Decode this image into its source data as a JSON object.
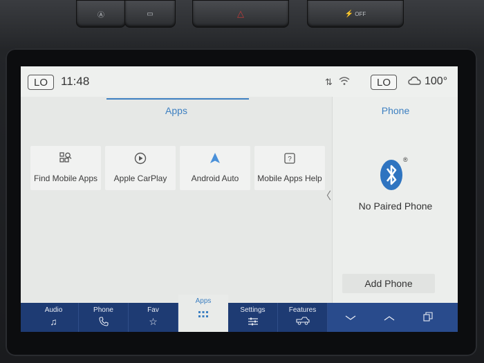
{
  "status": {
    "left_climate": "LO",
    "time": "11:48",
    "right_climate": "LO",
    "outside_temp": "100°"
  },
  "apps": {
    "title": "Apps",
    "tiles": [
      {
        "label": "Find Mobile Apps",
        "icon": "find-apps-icon"
      },
      {
        "label": "Apple CarPlay",
        "icon": "carplay-icon"
      },
      {
        "label": "Android Auto",
        "icon": "android-auto-icon"
      },
      {
        "label": "Mobile Apps Help",
        "icon": "help-icon"
      }
    ]
  },
  "phone": {
    "title": "Phone",
    "status": "No Paired Phone",
    "add_button": "Add Phone"
  },
  "nav": {
    "items": [
      {
        "label": "Audio",
        "icon": "music-note-icon"
      },
      {
        "label": "Phone",
        "icon": "phone-icon"
      },
      {
        "label": "Fav",
        "icon": "star-icon"
      },
      {
        "label": "Apps",
        "icon": "apps-grid-icon"
      },
      {
        "label": "Settings",
        "icon": "settings-sliders-icon"
      },
      {
        "label": "Features",
        "icon": "truck-icon"
      }
    ],
    "active": "Apps"
  },
  "dash_buttons": {
    "right_label": "OFF"
  },
  "colors": {
    "accent": "#3c7fc1",
    "navbar": "#1e3b73",
    "bluetooth": "#2f74c0"
  }
}
